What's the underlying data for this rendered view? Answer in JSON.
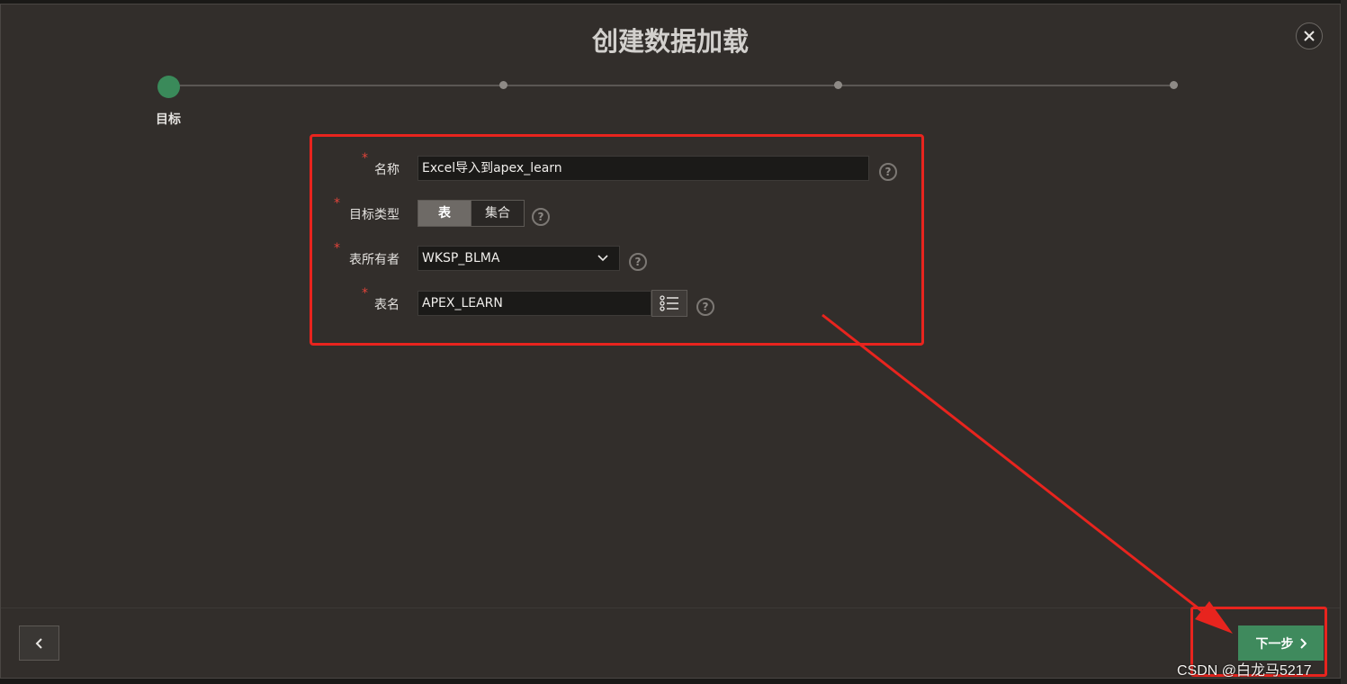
{
  "dialog": {
    "title": "创建数据加载",
    "close_icon": "close-icon"
  },
  "wizard": {
    "current_step_label": "目标",
    "step_count": 4,
    "current_step": 1
  },
  "form": {
    "name": {
      "label": "名称",
      "value": "Excel导入到apex_learn",
      "required_marker": "*"
    },
    "target_type": {
      "label": "目标类型",
      "required_marker": "*",
      "options": [
        "表",
        "集合"
      ],
      "selected": "表"
    },
    "table_owner": {
      "label": "表所有者",
      "required_marker": "*",
      "value": "WKSP_BLMA"
    },
    "table_name": {
      "label": "表名",
      "required_marker": "*",
      "value": "APEX_LEARN"
    },
    "help_glyph": "?"
  },
  "footer": {
    "back_icon": "chevron-left-icon",
    "next_label": "下一步"
  },
  "watermark": "CSDN @白龙马5217",
  "colors": {
    "accent_green": "#3f8a5d",
    "annotation_red": "#e8241e",
    "required_red": "#e0443a"
  }
}
